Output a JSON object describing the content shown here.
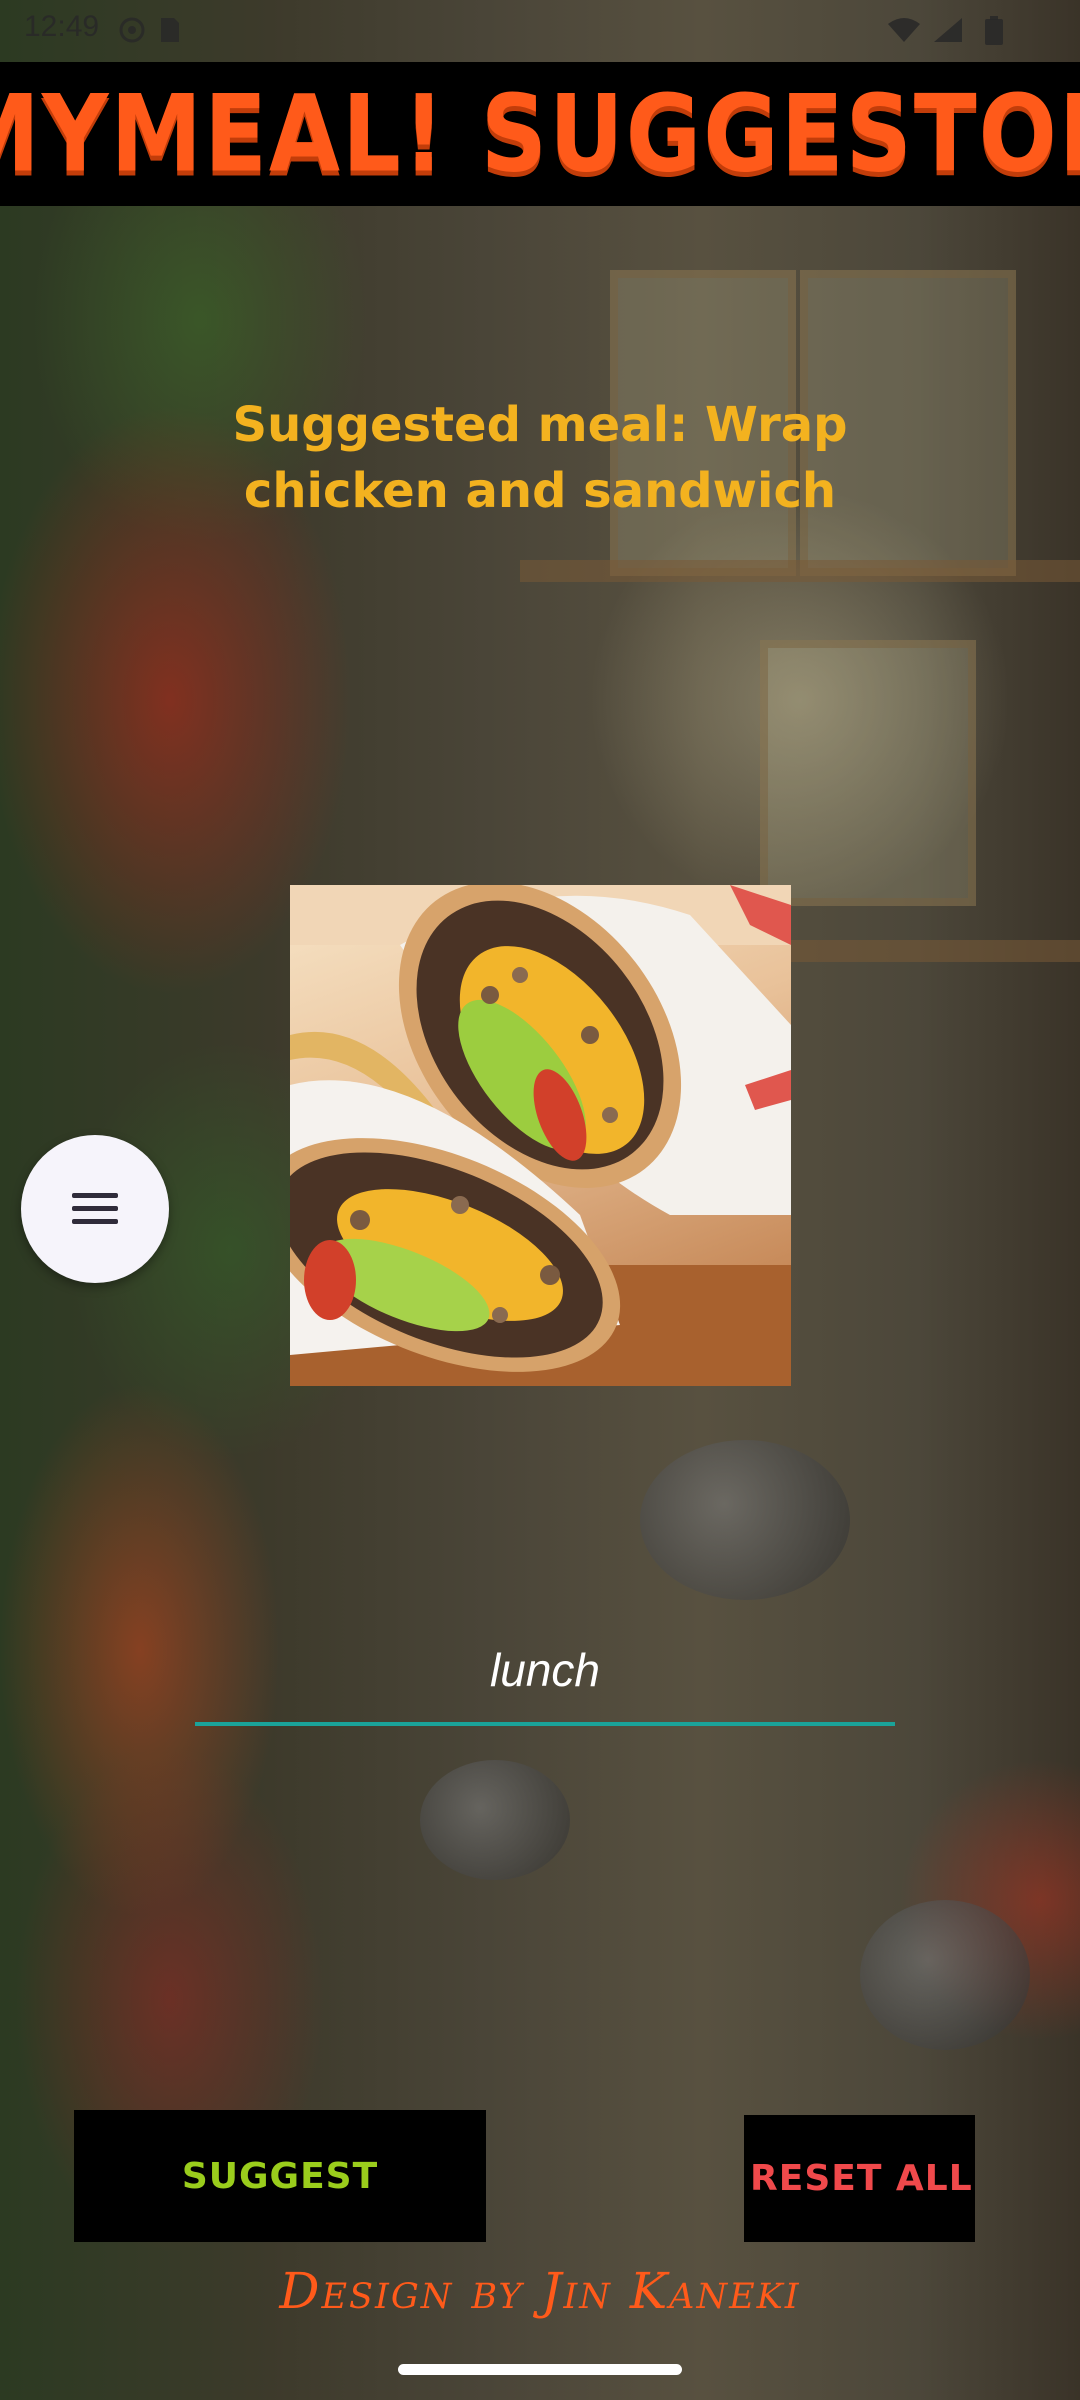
{
  "status_bar": {
    "time": "12:49",
    "icons": [
      "settings-icon",
      "sim-icon",
      "wifi-icon",
      "signal-icon",
      "battery-icon"
    ]
  },
  "header": {
    "title": "MYMEAL! SUGGESTOR"
  },
  "suggestion": {
    "text": "Suggested meal: Wrap chicken and sandwich",
    "image_alt": "Wrap chicken and sandwich"
  },
  "menu": {
    "icon": "menu-icon"
  },
  "meal_type": {
    "value": "lunch"
  },
  "actions": {
    "suggest_label": "SUGGEST",
    "reset_label": "RESET ALL"
  },
  "footer": {
    "credit": "Design by Jin Kaneki"
  },
  "colors": {
    "title": "#ff5a1a",
    "suggestion_text": "#f3b21f",
    "suggest_button_text": "#9acd1c",
    "reset_button_text": "#f0494b",
    "input_underline": "#1aa39a"
  }
}
